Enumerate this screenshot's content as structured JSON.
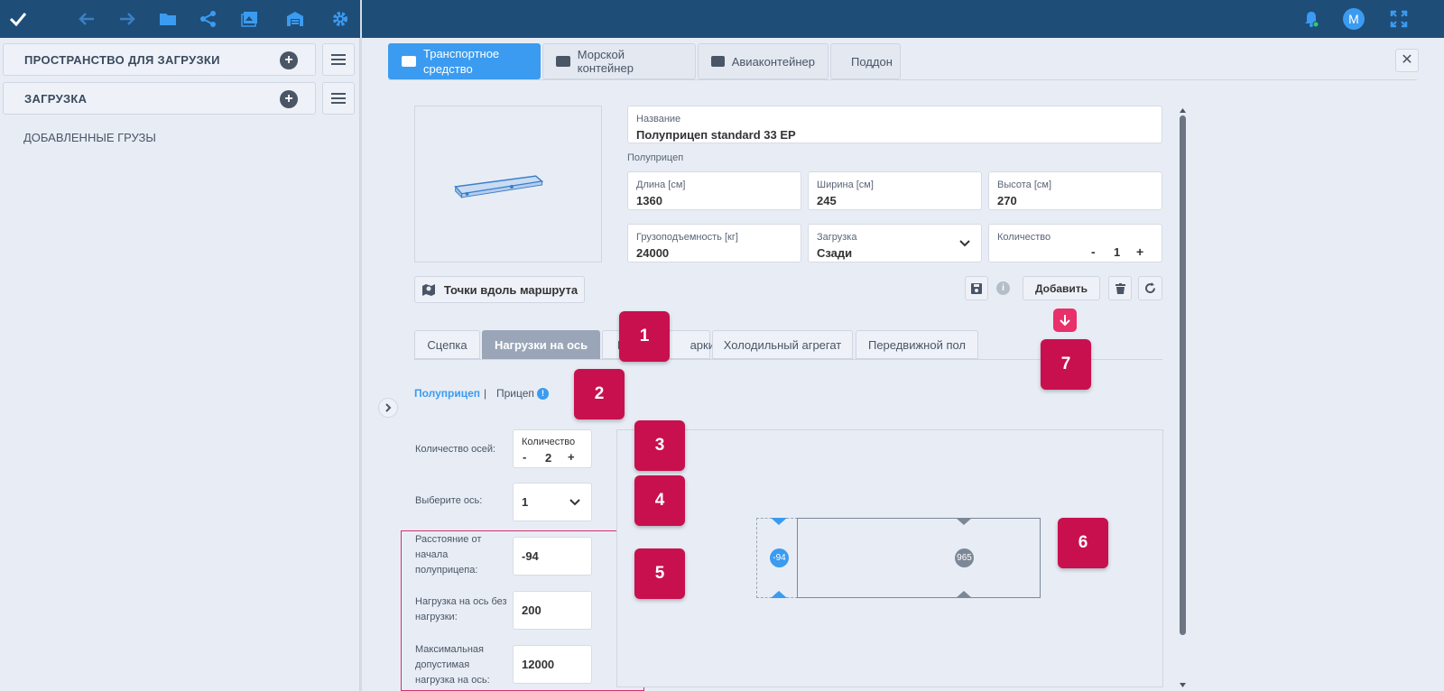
{
  "topbar": {
    "icons": [
      "check-icon",
      "arrow-left-icon",
      "arrow-right-icon",
      "folder-icon",
      "share-icon",
      "image-icon",
      "warehouse-icon",
      "settings-icon"
    ],
    "user_initial": "M"
  },
  "left": {
    "space_title": "ПРОСТРАНСТВО ДЛЯ ЗАГРУЗКИ",
    "load_title": "ЗАГРУЗКА",
    "added_cargo": "ДОБАВЛЕННЫЕ ГРУЗЫ"
  },
  "tabs": {
    "vehicle": "Транспортное средство",
    "sea": "Морской контейнер",
    "air": "Авиаконтейнер",
    "pallet": "Поддон"
  },
  "form": {
    "name_label": "Название",
    "name_value": "Полуприцеп standard 33 EP",
    "type": "Полуприцеп",
    "length_label": "Длина [см]",
    "length_value": "1360",
    "width_label": "Ширина [см]",
    "width_value": "245",
    "height_label": "Высота [см]",
    "height_value": "270",
    "capacity_label": "Грузоподъемность [кг]",
    "capacity_value": "24000",
    "loading_label": "Загрузка",
    "loading_value": "Сзади",
    "qty_label": "Количество",
    "qty_value": "1",
    "minus": "-",
    "plus": "+"
  },
  "actions": {
    "route_points": "Точки вдоль маршрута",
    "add": "Добавить"
  },
  "subtabs": {
    "coupling": "Сцепка",
    "axle_loads": "Нагрузки на ось",
    "marks_partial": "К",
    "marks_rest": "арки",
    "refrigerator": "Холодильный агрегат",
    "moving_floor": "Передвижной пол"
  },
  "axle": {
    "semi": "Полуприцеп",
    "sep": "|",
    "trailer": "Прицеп",
    "axles_count_label": "Количество осей:",
    "count_box_label": "Количество",
    "count_value": "2",
    "choose_axle_label": "Выберите ось:",
    "choose_axle_value": "1",
    "distance_label": "Расстояние от начала полуприцепа:",
    "distance_value": "-94",
    "empty_load_label": "Нагрузка на ось без нагрузки:",
    "empty_load_value": "200",
    "max_load_label": "Максимальная допустимая нагрузка на ось:",
    "max_load_value": "12000"
  },
  "diagram": {
    "marker1": "-94",
    "marker2": "965"
  },
  "badges": [
    "1",
    "2",
    "3",
    "4",
    "5",
    "6",
    "7"
  ],
  "colors": {
    "topbar": "#1e4d78",
    "accent": "#3b9bf0",
    "badge": "#c8104e"
  }
}
